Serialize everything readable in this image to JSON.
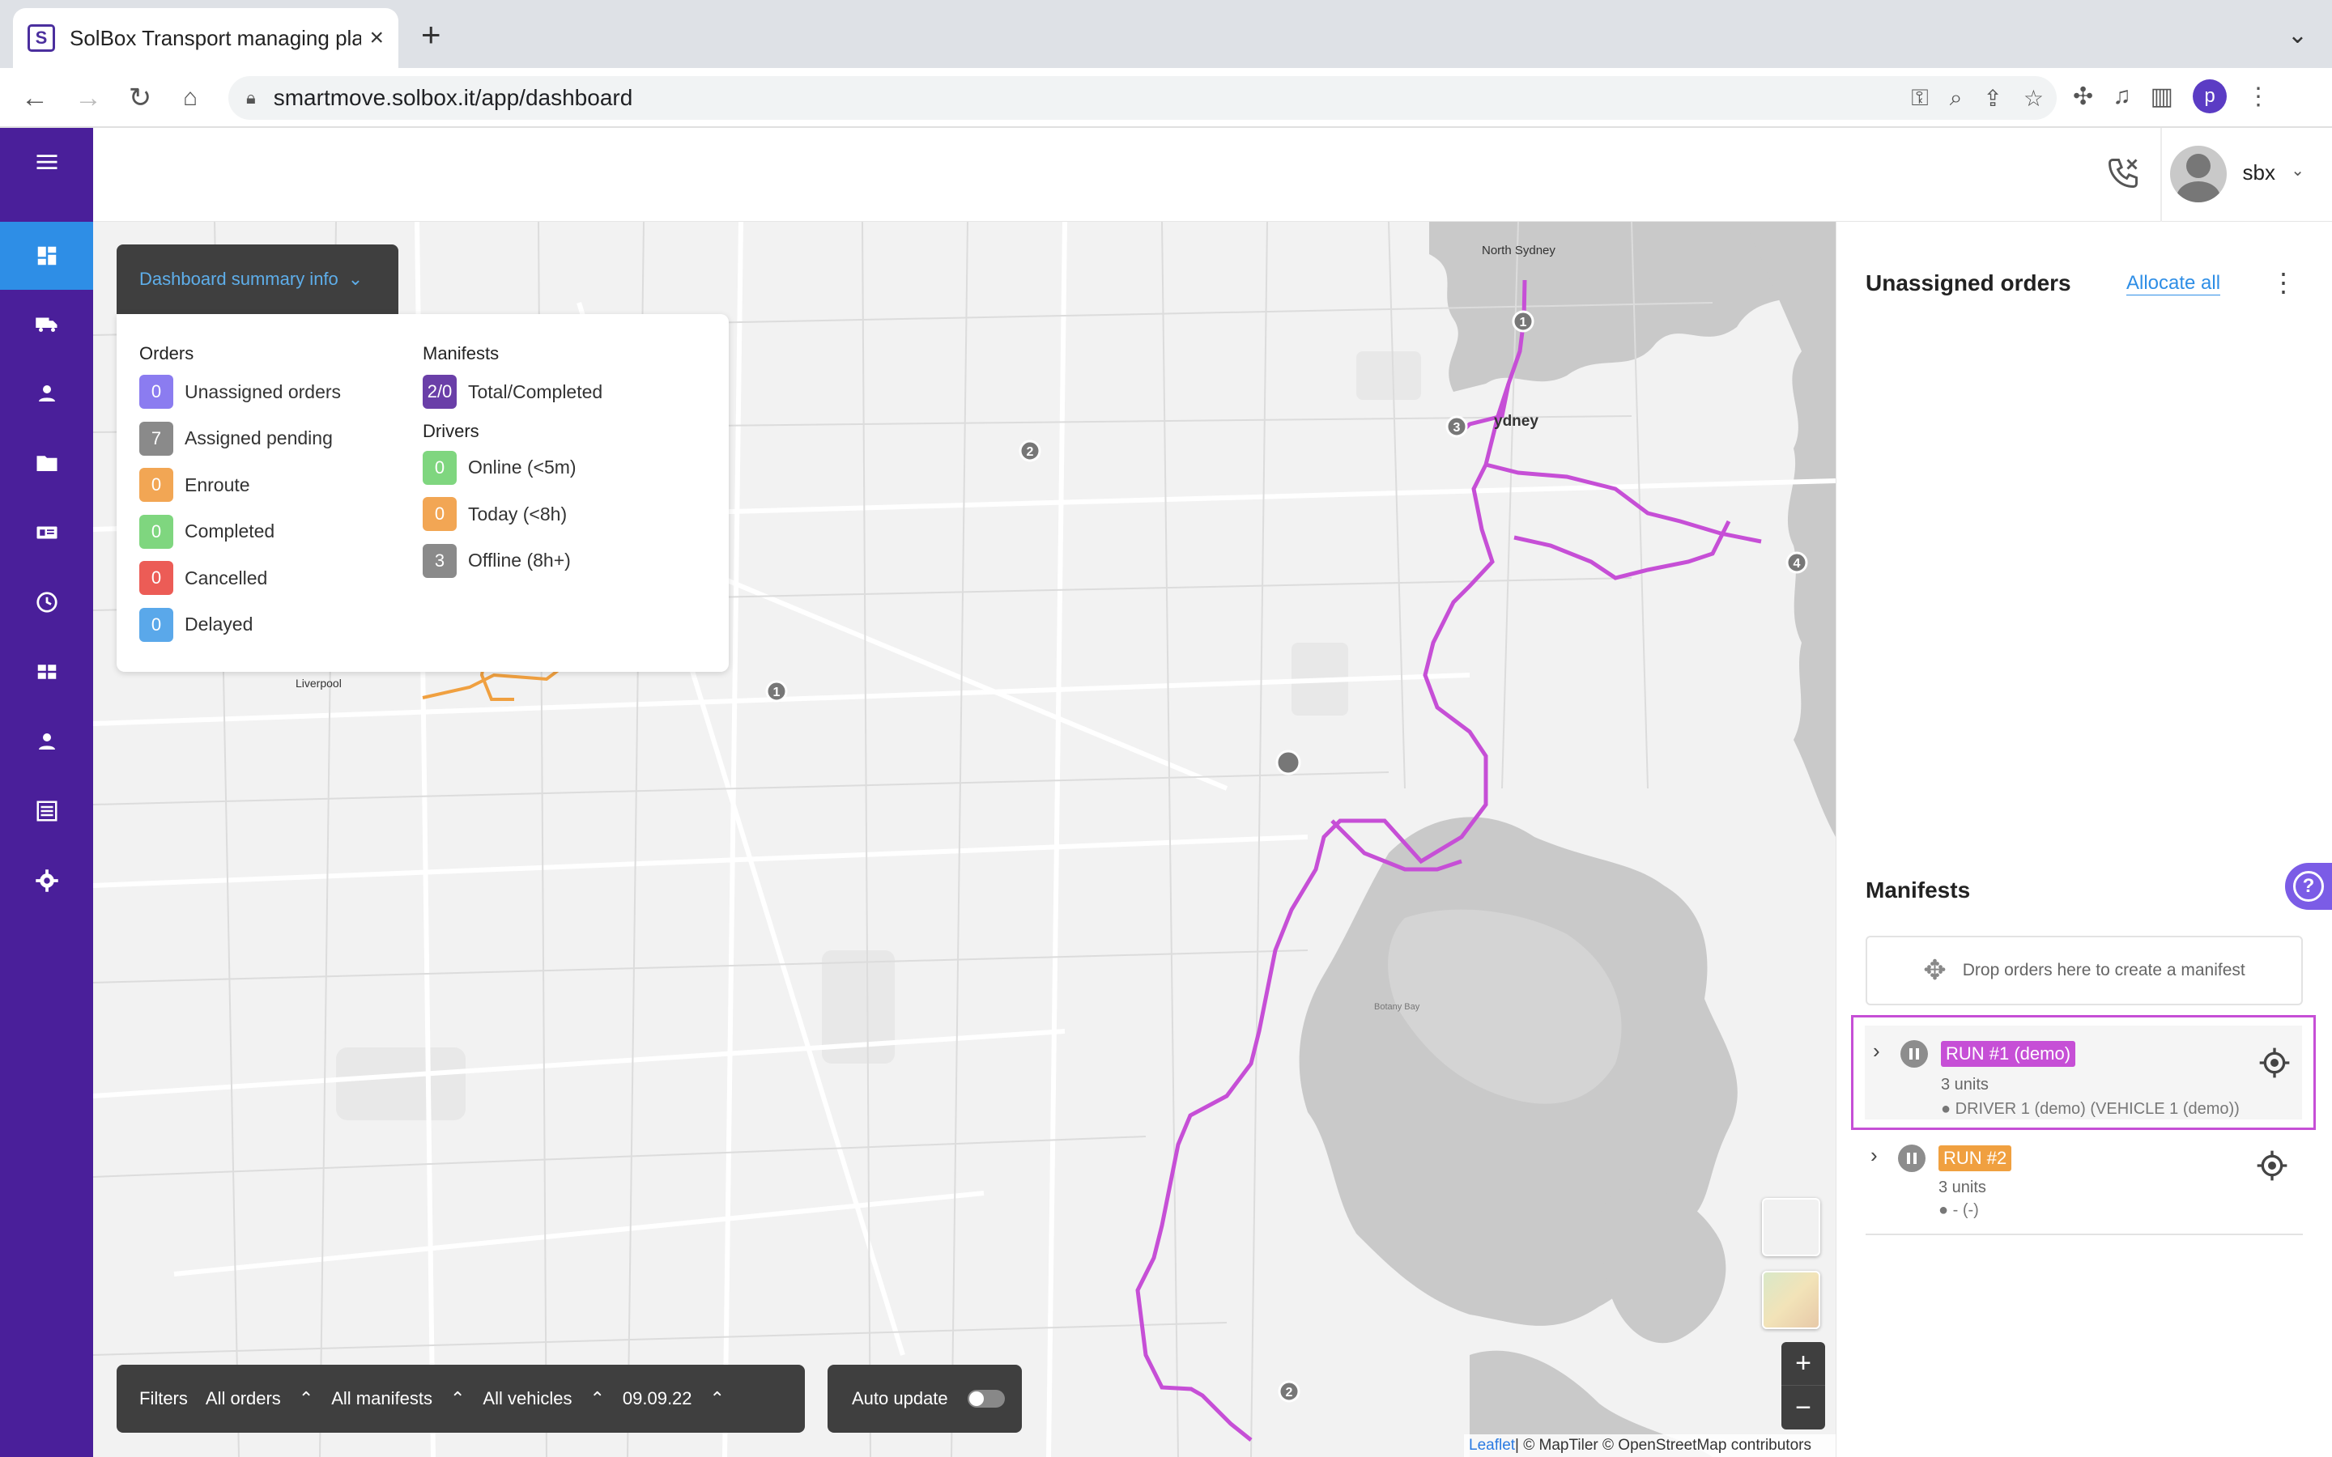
{
  "browser": {
    "tab_title": "SolBox Transport managing pla",
    "favicon_letter": "S",
    "url": "smartmove.solbox.it/app/dashboard",
    "profile_letter": "p"
  },
  "header": {
    "user_name": "sbx"
  },
  "summary": {
    "toggle_label": "Dashboard summary info",
    "orders_title": "Orders",
    "orders": [
      {
        "count": "0",
        "label": "Unassigned orders",
        "color": "#8b7cf0"
      },
      {
        "count": "7",
        "label": "Assigned pending",
        "color": "#8a8a8a"
      },
      {
        "count": "0",
        "label": "Enroute",
        "color": "#f2a654"
      },
      {
        "count": "0",
        "label": "Completed",
        "color": "#7fd67f"
      },
      {
        "count": "0",
        "label": "Cancelled",
        "color": "#ec5c56"
      },
      {
        "count": "0",
        "label": "Delayed",
        "color": "#5aa8ea"
      }
    ],
    "manifests_title": "Manifests",
    "manifests": {
      "count": "2/0",
      "label": "Total/Completed",
      "color": "#6a3fa8"
    },
    "drivers_title": "Drivers",
    "drivers": [
      {
        "count": "0",
        "label": "Online (<5m)",
        "color": "#7fd67f"
      },
      {
        "count": "0",
        "label": "Today (<8h)",
        "color": "#f2a654"
      },
      {
        "count": "3",
        "label": "Offline (8h+)",
        "color": "#8a8a8a"
      }
    ]
  },
  "filters": {
    "label": "Filters",
    "orders": "All orders",
    "manifests": "All manifests",
    "vehicles": "All vehicles",
    "date": "09.09.22",
    "auto_update": "Auto update"
  },
  "map": {
    "labels": {
      "north_sydney": "North Sydney",
      "sydney": "ydney",
      "liverpool": "Liverpool",
      "botany_bay": "Botany Bay"
    },
    "markers": {
      "m1": "1",
      "m2": "2",
      "m3": "3",
      "m4": "4"
    },
    "zoom_in": "+",
    "zoom_out": "−",
    "attrib_leaflet": "Leaflet",
    "attrib_rest": " | © MapTiler © OpenStreetMap contributors",
    "route_colors": {
      "manifest1": "#c64fd6",
      "manifest2": "#f0a040"
    }
  },
  "right_panel": {
    "unassigned_title": "Unassigned orders",
    "allocate_all": "Allocate all",
    "manifests_title": "Manifests",
    "drop_hint": "Drop orders here to create a manifest",
    "runs": [
      {
        "label": "RUN #1 (demo)",
        "color": "#c64fd6",
        "units": "3 units",
        "driver": "DRIVER 1 (demo) (VEHICLE 1 (demo))"
      },
      {
        "label": "RUN #2",
        "color": "#f0a040",
        "units": "3 units",
        "driver": "- (-)"
      }
    ]
  }
}
